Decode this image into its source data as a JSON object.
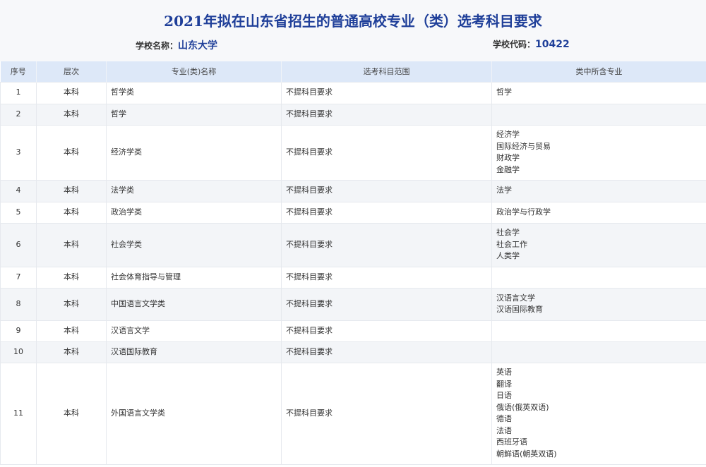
{
  "title": "2021年拟在山东省招生的普通高校专业（类）选考科目要求",
  "school_name_label": "学校名称：",
  "school_name": "山东大学",
  "school_code_label": "学校代码：",
  "school_code": "10422",
  "table": {
    "headers": [
      "序号",
      "层次",
      "专业(类)名称",
      "选考科目范围",
      "类中所含专业"
    ],
    "rows": [
      {
        "no": "1",
        "level": "本科",
        "name": "哲学类",
        "subjects": "不提科目要求",
        "majors": [
          "哲学"
        ]
      },
      {
        "no": "2",
        "level": "本科",
        "name": "哲学",
        "subjects": "不提科目要求",
        "majors": []
      },
      {
        "no": "3",
        "level": "本科",
        "name": "经济学类",
        "subjects": "不提科目要求",
        "majors": [
          "经济学",
          "国际经济与贸易",
          "财政学",
          "金融学"
        ]
      },
      {
        "no": "4",
        "level": "本科",
        "name": "法学类",
        "subjects": "不提科目要求",
        "majors": [
          "法学"
        ]
      },
      {
        "no": "5",
        "level": "本科",
        "name": "政治学类",
        "subjects": "不提科目要求",
        "majors": [
          "政治学与行政学"
        ]
      },
      {
        "no": "6",
        "level": "本科",
        "name": "社会学类",
        "subjects": "不提科目要求",
        "majors": [
          "社会学",
          "社会工作",
          "人类学"
        ]
      },
      {
        "no": "7",
        "level": "本科",
        "name": "社会体育指导与管理",
        "subjects": "不提科目要求",
        "majors": []
      },
      {
        "no": "8",
        "level": "本科",
        "name": "中国语言文学类",
        "subjects": "不提科目要求",
        "majors": [
          "汉语言文学",
          "汉语国际教育"
        ]
      },
      {
        "no": "9",
        "level": "本科",
        "name": "汉语言文学",
        "subjects": "不提科目要求",
        "majors": []
      },
      {
        "no": "10",
        "level": "本科",
        "name": "汉语国际教育",
        "subjects": "不提科目要求",
        "majors": []
      },
      {
        "no": "11",
        "level": "本科",
        "name": "外国语言文学类",
        "subjects": "不提科目要求",
        "majors": [
          "英语",
          "翻译",
          "日语",
          "俄语(俄英双语)",
          "德语",
          "法语",
          "西班牙语",
          "朝鲜语(朝英双语)"
        ]
      }
    ]
  }
}
